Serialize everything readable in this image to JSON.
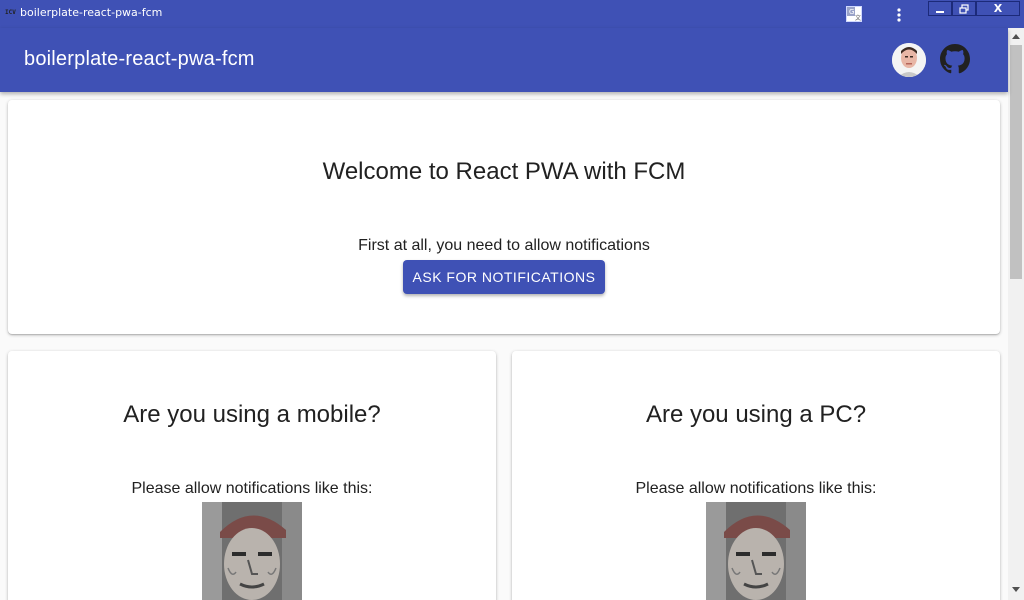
{
  "window": {
    "title": "boilerplate-react-pwa-fcm",
    "app_icon_text": "ICV",
    "controls": {
      "minimize_icon": "minimize-icon",
      "restore_icon": "restore-icon",
      "close_label": "X"
    },
    "translate_icon": "translate-icon",
    "menu_icon": "vertical-dots-icon"
  },
  "appbar": {
    "title": "boilerplate-react-pwa-fcm",
    "avatar_icon": "user-avatar",
    "github_icon": "github-icon"
  },
  "welcome_card": {
    "heading": "Welcome to React PWA with FCM",
    "text": "First at all, you need to allow notifications",
    "button_label": "ASK FOR NOTIFICATIONS"
  },
  "mobile_card": {
    "heading": "Are you using a mobile?",
    "text": "Please allow notifications like this:",
    "image": "man-portrait-photo"
  },
  "pc_card": {
    "heading": "Are you using a PC?",
    "text": "Please allow notifications like this:",
    "image": "man-portrait-photo"
  },
  "colors": {
    "primary": "#3f51b5",
    "background": "#fafafa",
    "card": "#ffffff",
    "text": "#212121"
  }
}
